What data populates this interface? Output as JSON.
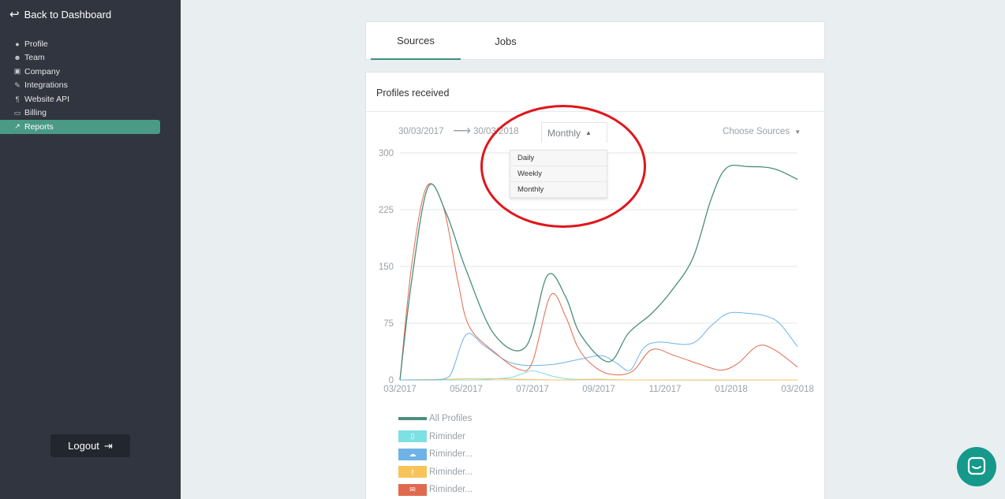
{
  "sidebar": {
    "back_label": "Back to Dashboard",
    "items": [
      {
        "label": "Profile",
        "icon": "person-icon",
        "glyph": "●"
      },
      {
        "label": "Team",
        "icon": "team-icon",
        "glyph": "☻"
      },
      {
        "label": "Company",
        "icon": "briefcase-icon",
        "glyph": "▣"
      },
      {
        "label": "Integrations",
        "icon": "plug-icon",
        "glyph": "✎"
      },
      {
        "label": "Website API",
        "icon": "api-icon",
        "glyph": "¶"
      },
      {
        "label": "Billing",
        "icon": "card-icon",
        "glyph": "▭"
      },
      {
        "label": "Reports",
        "icon": "chart-icon",
        "glyph": "↗",
        "active": true
      }
    ],
    "logout_label": "Logout"
  },
  "tabs": [
    {
      "label": "Sources",
      "active": true
    },
    {
      "label": "Jobs"
    }
  ],
  "card": {
    "title": "Profiles received",
    "date_from": "30/03/2017",
    "date_to": "30/03/2018",
    "period": "Monthly",
    "period_options": [
      "Daily",
      "Weekly",
      "Monthly"
    ],
    "sources_label": "Choose Sources"
  },
  "chart_data": {
    "type": "line",
    "xlim": [
      0,
      12
    ],
    "ylim": [
      0,
      300
    ],
    "yticks": [
      0,
      75,
      150,
      225,
      300
    ],
    "xticks": [
      {
        "x": 0,
        "label": "03/2017"
      },
      {
        "x": 2,
        "label": "05/2017"
      },
      {
        "x": 4,
        "label": "07/2017"
      },
      {
        "x": 6,
        "label": "09/2017"
      },
      {
        "x": 8,
        "label": "11/2017"
      },
      {
        "x": 10,
        "label": "01/2018"
      },
      {
        "x": 12,
        "label": "03/2018"
      }
    ],
    "grid": true,
    "series": [
      {
        "name": "All Profiles",
        "color": "#4a8e7c",
        "width": 1.3,
        "points": [
          [
            0,
            0
          ],
          [
            0.35,
            130
          ],
          [
            0.85,
            255
          ],
          [
            1.4,
            220
          ],
          [
            2,
            145
          ],
          [
            2.85,
            60
          ],
          [
            3.8,
            44
          ],
          [
            4.45,
            138
          ],
          [
            5,
            110
          ],
          [
            5.45,
            60
          ],
          [
            6.3,
            24
          ],
          [
            6.9,
            62
          ],
          [
            7.6,
            88
          ],
          [
            8.2,
            118
          ],
          [
            8.85,
            162
          ],
          [
            9.4,
            240
          ],
          [
            9.85,
            280
          ],
          [
            10.5,
            282
          ],
          [
            11.3,
            279
          ],
          [
            12,
            265
          ]
        ]
      },
      {
        "name": "Riminder",
        "color": "#7de0e3",
        "width": 1,
        "points": [
          [
            0,
            0
          ],
          [
            2,
            0
          ],
          [
            2.7,
            1
          ],
          [
            3.4,
            4
          ],
          [
            4,
            12
          ],
          [
            4.6,
            5
          ],
          [
            5.2,
            1
          ],
          [
            6,
            1
          ],
          [
            7,
            0
          ],
          [
            12,
            0
          ]
        ]
      },
      {
        "name": "Riminder...",
        "color": "#6eb2e8",
        "width": 1,
        "points": [
          [
            0,
            0
          ],
          [
            1,
            0
          ],
          [
            1.5,
            5
          ],
          [
            2,
            60
          ],
          [
            2.55,
            45
          ],
          [
            3.4,
            22
          ],
          [
            4.5,
            20
          ],
          [
            5.5,
            28
          ],
          [
            6.1,
            32
          ],
          [
            6.55,
            22
          ],
          [
            6.95,
            13
          ],
          [
            7.35,
            42
          ],
          [
            7.8,
            50
          ],
          [
            8.8,
            48
          ],
          [
            9.4,
            72
          ],
          [
            9.9,
            88
          ],
          [
            10.5,
            88
          ],
          [
            11,
            85
          ],
          [
            11.45,
            75
          ],
          [
            12,
            44
          ]
        ]
      },
      {
        "name": "Riminder...",
        "color": "#f8c45a",
        "width": 1,
        "points": [
          [
            0,
            0
          ],
          [
            1.5,
            1
          ],
          [
            2.5,
            2
          ],
          [
            3.5,
            1
          ],
          [
            5,
            0
          ],
          [
            6,
            1
          ],
          [
            7,
            0
          ],
          [
            12,
            0
          ]
        ]
      },
      {
        "name": "Riminder...",
        "color": "#e06a4e",
        "width": 1,
        "points": [
          [
            0,
            0
          ],
          [
            0.35,
            150
          ],
          [
            0.8,
            255
          ],
          [
            1.3,
            230
          ],
          [
            1.75,
            130
          ],
          [
            2.1,
            70
          ],
          [
            2.9,
            35
          ],
          [
            3.6,
            14
          ],
          [
            4,
            24
          ],
          [
            4.55,
            112
          ],
          [
            5,
            84
          ],
          [
            5.35,
            45
          ],
          [
            5.75,
            22
          ],
          [
            6.3,
            8
          ],
          [
            7,
            11
          ],
          [
            7.6,
            40
          ],
          [
            8.3,
            32
          ],
          [
            9.1,
            20
          ],
          [
            9.7,
            13
          ],
          [
            10.2,
            22
          ],
          [
            10.8,
            45
          ],
          [
            11.3,
            40
          ],
          [
            12,
            17
          ]
        ]
      }
    ]
  },
  "legend": [
    {
      "name": "All Profiles",
      "color": "#4a8e7c",
      "kind": "line"
    },
    {
      "name": "Riminder",
      "color": "#7de0e3",
      "kind": "box",
      "icon": "document-icon",
      "glyph": "▯"
    },
    {
      "name": "Riminder...",
      "color": "#6eb2e8",
      "kind": "box",
      "icon": "cloud-upload-icon",
      "glyph": "☁"
    },
    {
      "name": "Riminder...",
      "color": "#f8c45a",
      "kind": "box",
      "icon": "facebook-icon",
      "glyph": "f"
    },
    {
      "name": "Riminder...",
      "color": "#e06a4e",
      "kind": "box",
      "icon": "envelope-icon",
      "glyph": "✉"
    }
  ],
  "colors": {
    "sidebar_bg": "#30353f",
    "accent": "#4a9a86",
    "annotation": "#e0161c",
    "chat_bubble": "#14998a"
  }
}
